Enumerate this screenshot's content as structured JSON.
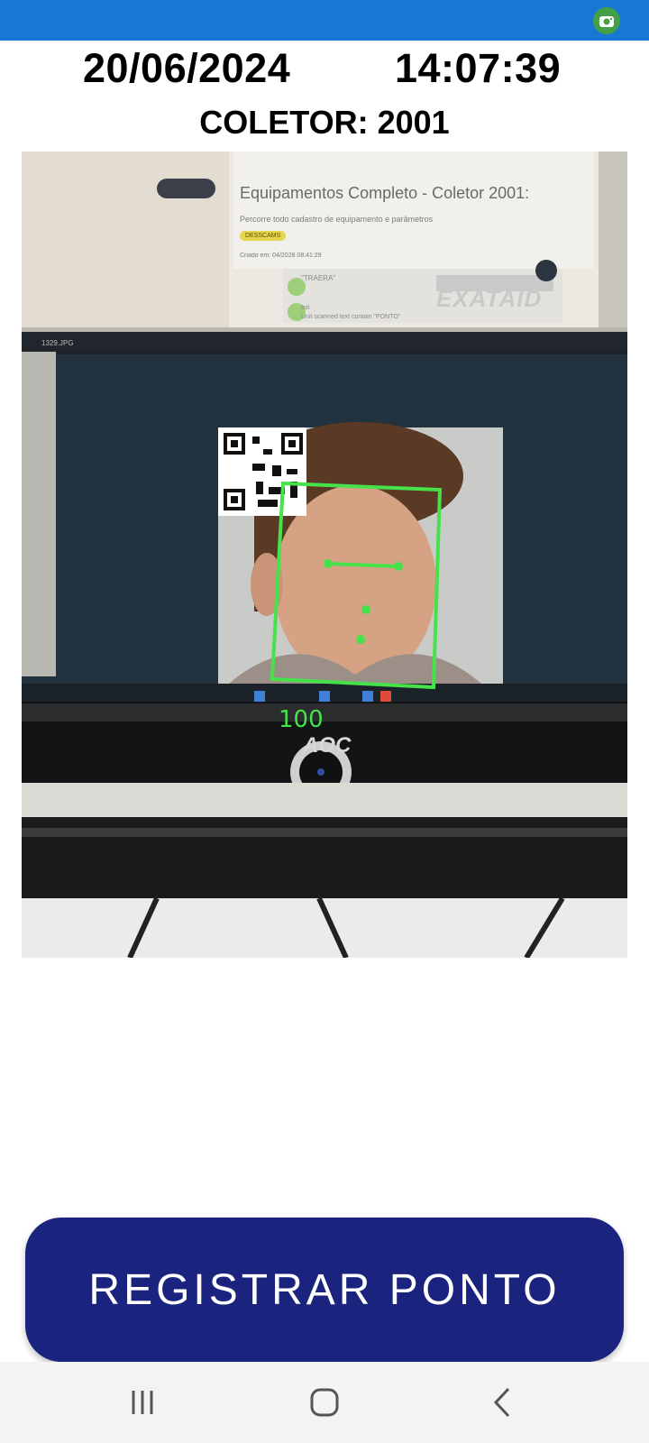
{
  "status_bar": {
    "color": "#1976d2",
    "notification_icon": "camera-icon",
    "notification_color": "#43a047"
  },
  "header": {
    "date": "20/06/2024",
    "time": "14:07:39",
    "collector": "COLETOR: 2001"
  },
  "camera": {
    "screen_heading": "Equipamentos Completo - Coletor 2001:",
    "screen_subtitle": "Percorre todo cadastro de equipamento e parâmetros",
    "screen_tag": "DESSCAMS",
    "screen_row1": "Criado em: 04/2028 08:41:29",
    "screen_row2": "\"TRAERA\"",
    "screen_row3a": "Init",
    "screen_row3b": "Unit scanned text contain \"PONTO\"",
    "screen_brand": "EXATAID",
    "taskbar_file": "1329.JPG",
    "monitor_brand": "AOC",
    "face_score": "100",
    "overlay_color": "#46e24a"
  },
  "actions": {
    "register_label": "REGISTRAR PONTO",
    "register_color": "#1a237e"
  },
  "nav_bar": {
    "recents_icon": "recents-icon",
    "home_icon": "home-icon",
    "back_icon": "back-icon"
  }
}
